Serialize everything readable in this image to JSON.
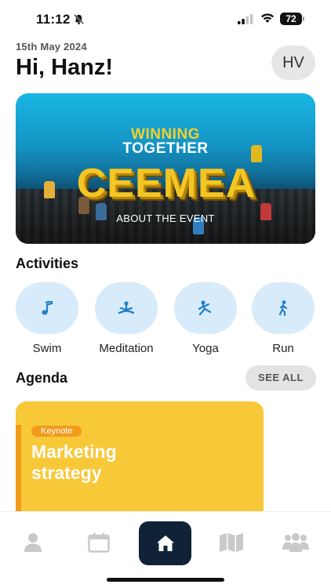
{
  "status_bar": {
    "time": "11:12",
    "battery": "72"
  },
  "header": {
    "date": "15th May 2024",
    "greeting": "Hi, Hanz!",
    "avatar_initials": "HV"
  },
  "banner": {
    "tagline_1": "WINNING",
    "tagline_2": "TOGETHER",
    "logo_text": "CEEMEA",
    "cta": "ABOUT THE EVENT"
  },
  "activities": {
    "title": "Activities",
    "items": [
      {
        "label": "Swim",
        "icon": "music-note-icon"
      },
      {
        "label": "Meditation",
        "icon": "meditation-icon"
      },
      {
        "label": "Yoga",
        "icon": "yoga-icon"
      },
      {
        "label": "Run",
        "icon": "run-icon"
      }
    ]
  },
  "agenda": {
    "title": "Agenda",
    "see_all": "SEE ALL",
    "cards": [
      {
        "badge": "Keynote",
        "title": "Marketing strategy"
      }
    ]
  },
  "nav": {
    "items": [
      "profile-icon",
      "calendar-icon",
      "home-icon",
      "map-icon",
      "people-icon"
    ],
    "active": "home-icon"
  },
  "colors": {
    "accent_navy": "#0f2238",
    "activity_bg": "#d7ebfb",
    "activity_icon": "#1f7fc9",
    "agenda_card": "#f7c838",
    "agenda_badge": "#f29a1c"
  }
}
